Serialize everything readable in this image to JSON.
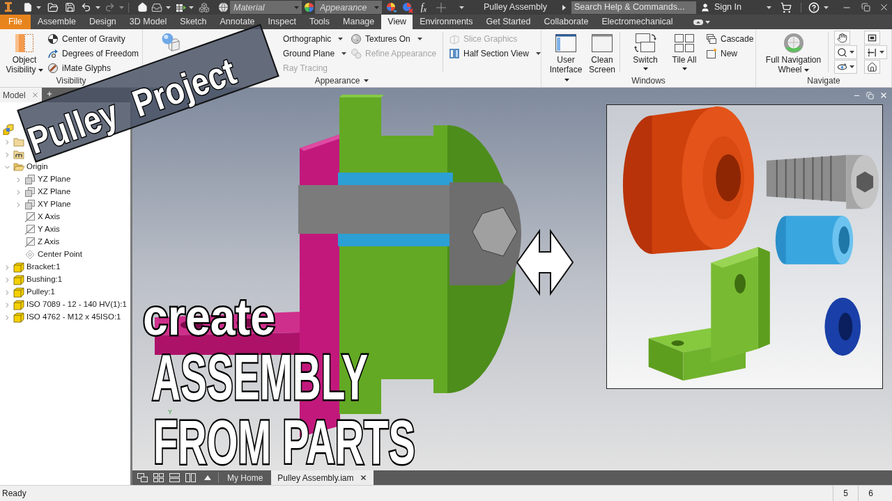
{
  "title_bar": {
    "material": {
      "placeholder": "Material"
    },
    "appearance": {
      "placeholder": "Appearance"
    },
    "formula": "f$_{x}$",
    "title": "Pulley Assembly",
    "search": {
      "placeholder": "Search Help & Commands..."
    },
    "sign_in": "Sign In"
  },
  "ribbon_tabs": [
    {
      "label": "File",
      "kind": "file",
      "selected": false
    },
    {
      "label": "Assemble",
      "kind": "tab",
      "selected": false
    },
    {
      "label": "Design",
      "kind": "tab",
      "selected": false
    },
    {
      "label": "3D Model",
      "kind": "tab",
      "selected": false
    },
    {
      "label": "Sketch",
      "kind": "tab",
      "selected": false
    },
    {
      "label": "Annotate",
      "kind": "tab",
      "selected": false
    },
    {
      "label": "Inspect",
      "kind": "tab",
      "selected": false
    },
    {
      "label": "Tools",
      "kind": "tab",
      "selected": false
    },
    {
      "label": "Manage",
      "kind": "tab",
      "selected": false
    },
    {
      "label": "View",
      "kind": "tab",
      "selected": true
    },
    {
      "label": "Environments",
      "kind": "tab",
      "selected": false
    },
    {
      "label": "Get Started",
      "kind": "tab",
      "selected": false
    },
    {
      "label": "Collaborate",
      "kind": "tab",
      "selected": false
    },
    {
      "label": "Electromechanical",
      "kind": "tab",
      "selected": false
    }
  ],
  "ribbon_panels": [
    {
      "title": "Visibility",
      "menu": false,
      "groups": [
        {
          "kind": "large",
          "label": "Object Visibility",
          "dropdown": true
        },
        {
          "kind": "stack",
          "items": [
            {
              "label": "Center of Gravity",
              "dropdown": false,
              "disabled": false
            },
            {
              "label": "Degrees of Freedom",
              "dropdown": false,
              "disabled": false
            },
            {
              "label": "iMate Glyphs",
              "dropdown": false,
              "disabled": false
            }
          ]
        }
      ]
    },
    {
      "title": "Appearance",
      "menu": true,
      "groups": [
        {
          "kind": "large"
        },
        {
          "kind": "stack",
          "items": [
            {
              "label": "Orthographic",
              "dropdown": true,
              "disabled": false
            },
            {
              "label": "Ground Plane",
              "dropdown": true,
              "disabled": false
            },
            {
              "label": "Ray Tracing",
              "dropdown": false,
              "disabled": true
            }
          ]
        },
        {
          "kind": "stack",
          "items": [
            {
              "label": "Textures On",
              "dropdown": true,
              "disabled": false
            },
            {
              "label": "Refine Appearance",
              "dropdown": false,
              "disabled": true
            }
          ]
        },
        {
          "kind": "stack",
          "items": [
            {
              "label": "Slice Graphics",
              "dropdown": false,
              "disabled": true
            },
            {
              "label": "Half Section View",
              "dropdown": true,
              "disabled": false
            }
          ]
        }
      ]
    },
    {
      "title": "Windows",
      "menu": false,
      "groups": [
        {
          "kind": "large",
          "label": "User Interface",
          "dropdown": true
        },
        {
          "kind": "large",
          "label": "Clean Screen",
          "dropdown": false
        },
        {
          "kind": "large",
          "label": "Switch",
          "dropdown": true
        },
        {
          "kind": "large",
          "label": "Tile All",
          "dropdown": true
        },
        {
          "kind": "stack",
          "items": [
            {
              "label": "Cascade",
              "dropdown": false,
              "disabled": false
            },
            {
              "label": "New",
              "dropdown": false,
              "disabled": false
            }
          ]
        }
      ]
    },
    {
      "title": "Navigate",
      "menu": false,
      "groups": [
        {
          "kind": "large",
          "label": "Full Navigation Wheel",
          "dropdown": true
        },
        {
          "kind": "icons",
          "items": [
            {
              "dropdown": false
            },
            {
              "dropdown": true
            },
            {
              "dropdown": true
            }
          ]
        },
        {
          "kind": "icons",
          "items": [
            {
              "dropdown": false
            },
            {
              "dropdown": true
            },
            {
              "dropdown": false
            }
          ]
        }
      ]
    }
  ],
  "browser": {
    "tabs": [
      {
        "label": "Model",
        "selected": true
      }
    ],
    "tree": [
      {
        "kind": "assembly",
        "children": [
          {
            "kind": "folder",
            "expanded": false
          },
          {
            "kind": "representations",
            "expanded": false
          },
          {
            "label": "Origin",
            "kind": "folder",
            "expanded": true,
            "children": [
              {
                "label": "YZ Plane",
                "kind": "plane",
                "expanded": false
              },
              {
                "label": "XZ Plane",
                "kind": "plane",
                "expanded": false
              },
              {
                "label": "XY Plane",
                "kind": "plane",
                "expanded": false
              },
              {
                "label": "X Axis",
                "kind": "axis"
              },
              {
                "label": "Y Axis",
                "kind": "axis"
              },
              {
                "label": "Z Axis",
                "kind": "axis"
              },
              {
                "label": "Center Point",
                "kind": "point"
              }
            ]
          },
          {
            "label": "Bracket:1",
            "kind": "part",
            "expanded": false
          },
          {
            "label": "Bushing:1",
            "kind": "part",
            "expanded": false
          },
          {
            "label": "Pulley:1",
            "kind": "part",
            "expanded": false
          },
          {
            "label": "ISO 7089 - 12 - 140 HV(1):1",
            "kind": "part",
            "expanded": false
          },
          {
            "label": "ISO 4762 - M12 x 45ISO:1",
            "kind": "part",
            "expanded": false
          }
        ]
      }
    ]
  },
  "viewport": {
    "axis_label": "Y"
  },
  "overlay": {
    "banner": [
      "Pulley",
      "Project"
    ],
    "headline": [
      "create",
      "ASSEMBLY",
      "FROM PARTS"
    ]
  },
  "document_tabs": [
    {
      "label": "My Home",
      "selected": false
    },
    {
      "label": "Pulley Assembly.iam",
      "selected": true
    }
  ],
  "status_bar": {
    "message": "Ready",
    "cells": [
      "5",
      "6"
    ]
  }
}
